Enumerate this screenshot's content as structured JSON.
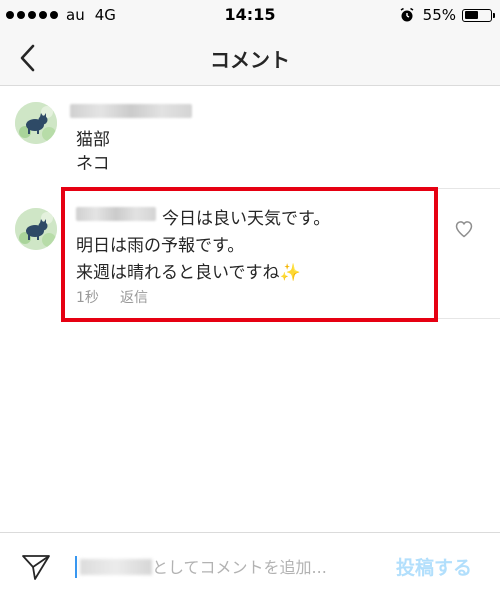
{
  "status_bar": {
    "carrier": "au",
    "network": "4G",
    "time": "14:15",
    "battery": "55%"
  },
  "header": {
    "title": "コメント",
    "back_icon": "chevron-left-icon"
  },
  "caption": {
    "lines": [
      "猫部",
      "ネコ"
    ]
  },
  "comment": {
    "lines": [
      "今日は良い天気です。",
      "明日は雨の予報です。",
      "来週は晴れると良いですね✨"
    ],
    "time": "1秒",
    "reply_label": "返信",
    "like_icon": "heart-outline-icon"
  },
  "input_bar": {
    "send_icon": "paper-plane-icon",
    "placeholder": "としてコメントを追加...",
    "post_label": "投稿する"
  },
  "colors": {
    "highlight": "#e60012",
    "post_disabled": "#b2dffc",
    "caret": "#3897f0"
  }
}
